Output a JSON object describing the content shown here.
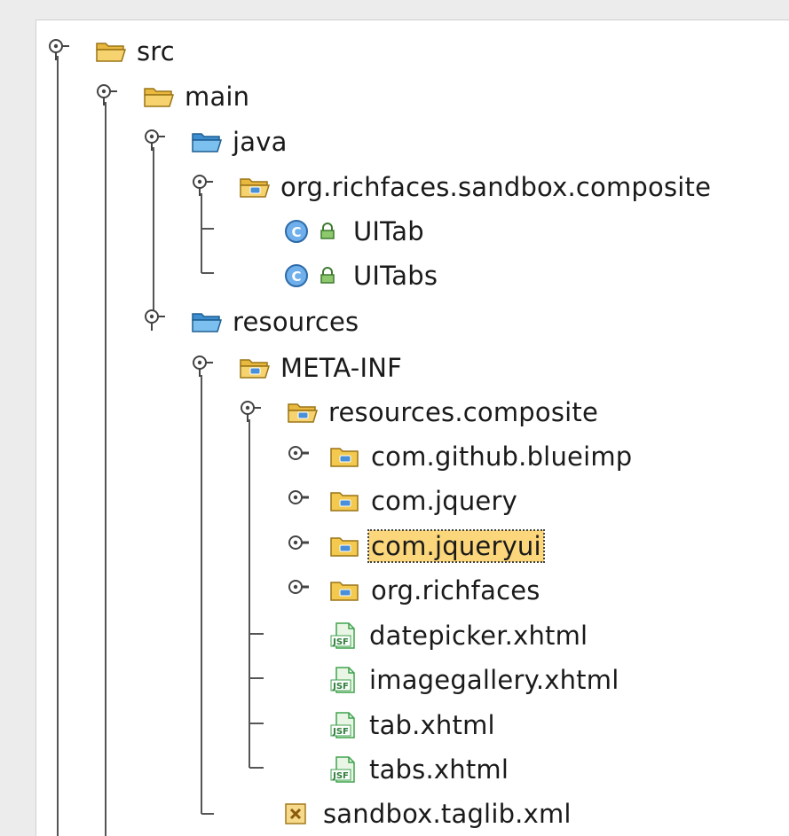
{
  "tree": {
    "src": {
      "label": "src",
      "icon": "folder-open-icon"
    },
    "main": {
      "label": "main",
      "icon": "folder-open-icon"
    },
    "java": {
      "label": "java",
      "icon": "source-folder-icon"
    },
    "pkg_composite": {
      "label": "org.richfaces.sandbox.composite",
      "icon": "package-open-icon"
    },
    "uitab": {
      "label": "UITab",
      "icon": "class-icon",
      "badge": "lock-icon"
    },
    "uitabs": {
      "label": "UITabs",
      "icon": "class-icon",
      "badge": "lock-icon"
    },
    "resources": {
      "label": "resources",
      "icon": "source-folder-icon"
    },
    "meta_inf": {
      "label": "META-INF",
      "icon": "package-open-icon"
    },
    "resources_composite": {
      "label": "resources.composite",
      "icon": "package-open-icon"
    },
    "com_github_blueimp": {
      "label": "com.github.blueimp",
      "icon": "package-icon"
    },
    "com_jquery": {
      "label": "com.jquery",
      "icon": "package-icon"
    },
    "com_jqueryui": {
      "label": "com.jqueryui",
      "icon": "package-icon",
      "selected": true
    },
    "org_richfaces": {
      "label": "org.richfaces",
      "icon": "package-icon"
    },
    "datepicker": {
      "label": "datepicker.xhtml",
      "icon": "jsf-file-icon"
    },
    "imagegallery": {
      "label": "imagegallery.xhtml",
      "icon": "jsf-file-icon"
    },
    "tab": {
      "label": "tab.xhtml",
      "icon": "jsf-file-icon"
    },
    "tabs": {
      "label": "tabs.xhtml",
      "icon": "jsf-file-icon"
    },
    "taglib": {
      "label": "sandbox.taglib.xml",
      "icon": "xml-file-icon"
    }
  },
  "colors": {
    "selection": "#fbd67a",
    "folder": "#f2c94c",
    "source_folder": "#5aa9e6",
    "class_badge": "#4a90d9",
    "jsf": "#3fa34d"
  }
}
